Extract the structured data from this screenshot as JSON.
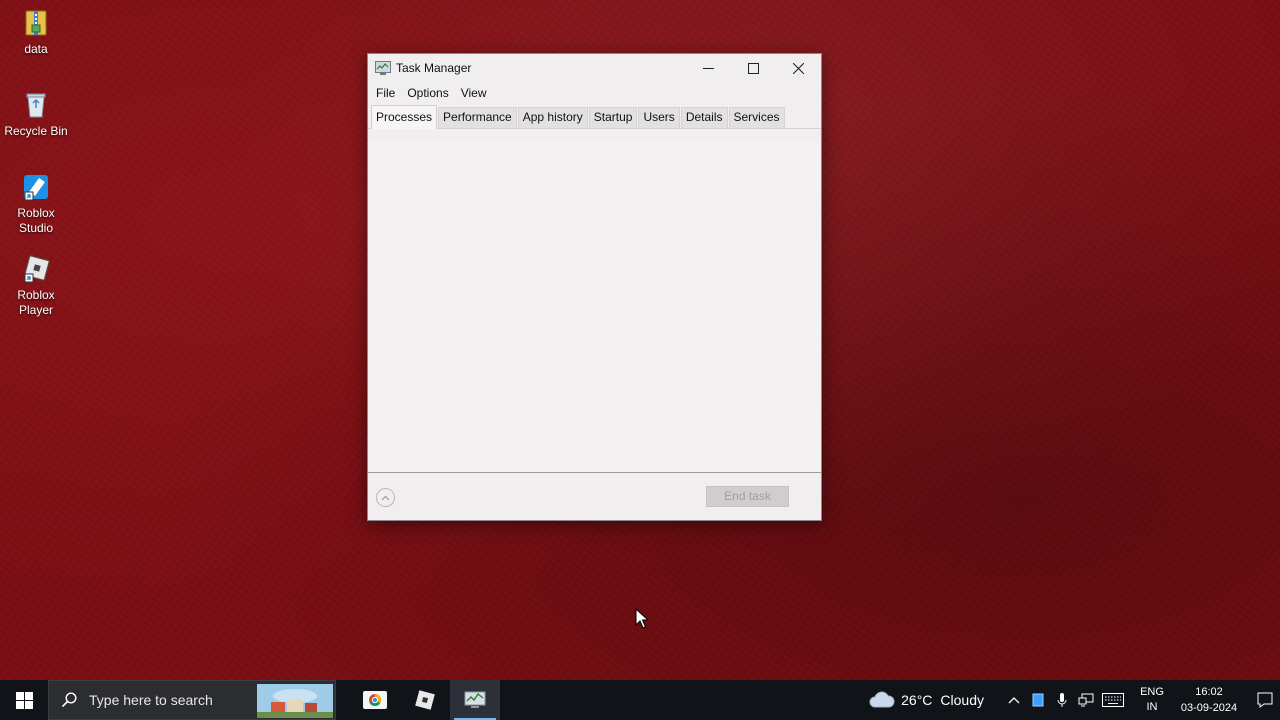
{
  "desktop": {
    "icons": [
      {
        "label": "data"
      },
      {
        "label": "Recycle Bin"
      },
      {
        "label": "Roblox Studio"
      },
      {
        "label": "Roblox Player"
      }
    ]
  },
  "window": {
    "title": "Task Manager",
    "menu": [
      "File",
      "Options",
      "View"
    ],
    "tabs": [
      "Processes",
      "Performance",
      "App history",
      "Startup",
      "Users",
      "Details",
      "Services"
    ],
    "active_tab": "Processes",
    "end_task_label": "End task",
    "end_task_enabled": false
  },
  "taskbar": {
    "search_placeholder": "Type here to search",
    "weather": {
      "temperature": "26°C",
      "condition": "Cloudy"
    },
    "language": {
      "line1": "ENG",
      "line2": "IN"
    },
    "clock": {
      "time": "16:02",
      "date": "03-09-2024"
    },
    "pinned_apps": [
      "chrome-icon",
      "roblox-icon",
      "task-manager-icon"
    ],
    "accent_color": "#76b9ed"
  },
  "colors": {
    "desktop_background": "#7c0f14",
    "taskbar_background": "#101318",
    "window_background": "#f0eeee"
  }
}
